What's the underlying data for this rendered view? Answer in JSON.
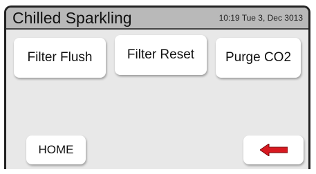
{
  "header": {
    "title": "Chilled Sparkling",
    "datetime": "10:19 Tue 3, Dec 3013"
  },
  "buttons": {
    "filter_flush": "Filter Flush",
    "filter_reset": "Filter Reset",
    "purge_co2": "Purge CO2",
    "home": "HOME"
  },
  "icons": {
    "back": "left-arrow-icon",
    "back_color": "#d71920"
  },
  "colors": {
    "title_bar": "#b9b9b9",
    "background": "#e8e8e8"
  }
}
